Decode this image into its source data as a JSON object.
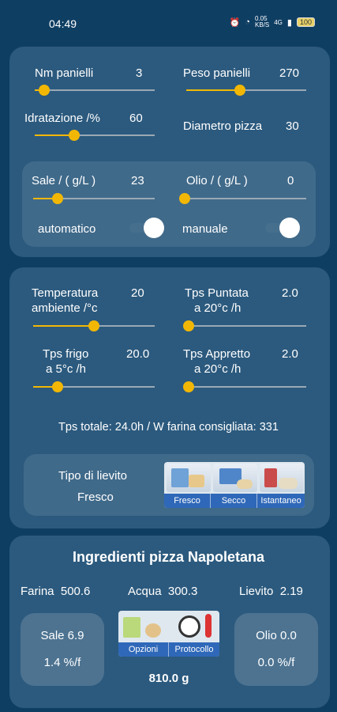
{
  "status": {
    "time": "04:49",
    "net_speed": "0.05\nKB/S",
    "signal": "4G",
    "battery": "100"
  },
  "dough": {
    "nm_panielli": {
      "label": "Nm panielli",
      "value": "3",
      "level": 0.08
    },
    "peso_panielli": {
      "label": "Peso panielli",
      "value": "270",
      "level": 0.45
    },
    "idratazione": {
      "label": "Idratazione /%",
      "value": "60",
      "level": 0.33
    },
    "diametro": {
      "label": "Diametro pizza",
      "value": "30"
    }
  },
  "salt_oil": {
    "sale": {
      "label": "Sale / ( g/L )",
      "value": "23",
      "level": 0.2
    },
    "olio": {
      "label": "Olio / ( g/L )",
      "value": "0",
      "level": 0.0
    },
    "automatico": {
      "label": "automatico",
      "on": true
    },
    "manuale": {
      "label": "manuale",
      "on": true
    }
  },
  "timing": {
    "temperatura": {
      "label1": "Temperatura",
      "label2": "ambiente /°c",
      "value": "20",
      "level": 0.5
    },
    "puntata": {
      "label1": "Tps Puntata",
      "label2": "a 20°c /h",
      "value": "2.0",
      "level": 0.03
    },
    "frigo": {
      "label1": "Tps frigo",
      "label2": "a 5°c /h",
      "value": "20.0",
      "level": 0.2
    },
    "appretto": {
      "label1": "Tps Appretto",
      "label2": "a 20°c /h",
      "value": "2.0",
      "level": 0.03
    },
    "summary": "Tps totale: 24.0h / W farina consigliata: 331"
  },
  "yeast": {
    "label": "Tipo di lievito",
    "selected": "Fresco",
    "options": [
      "Fresco",
      "Secco",
      "Istantaneo"
    ]
  },
  "ingredients": {
    "title": "Ingredienti pizza Napoletana",
    "farina": "Farina  500.6",
    "acqua": "Acqua  300.3",
    "lievito": "Lievito  2.19",
    "sale_g": "Sale 6.9",
    "sale_pct": "1.4 %/f",
    "olio_g": "Olio 0.0",
    "olio_pct": "0.0 %/f",
    "total": "810.0 g",
    "tools": [
      "Opzioni",
      "Protocollo"
    ]
  },
  "colors": {
    "background": "#0f3e63",
    "card": "#2c5a7e",
    "accent": "#f2b705"
  }
}
